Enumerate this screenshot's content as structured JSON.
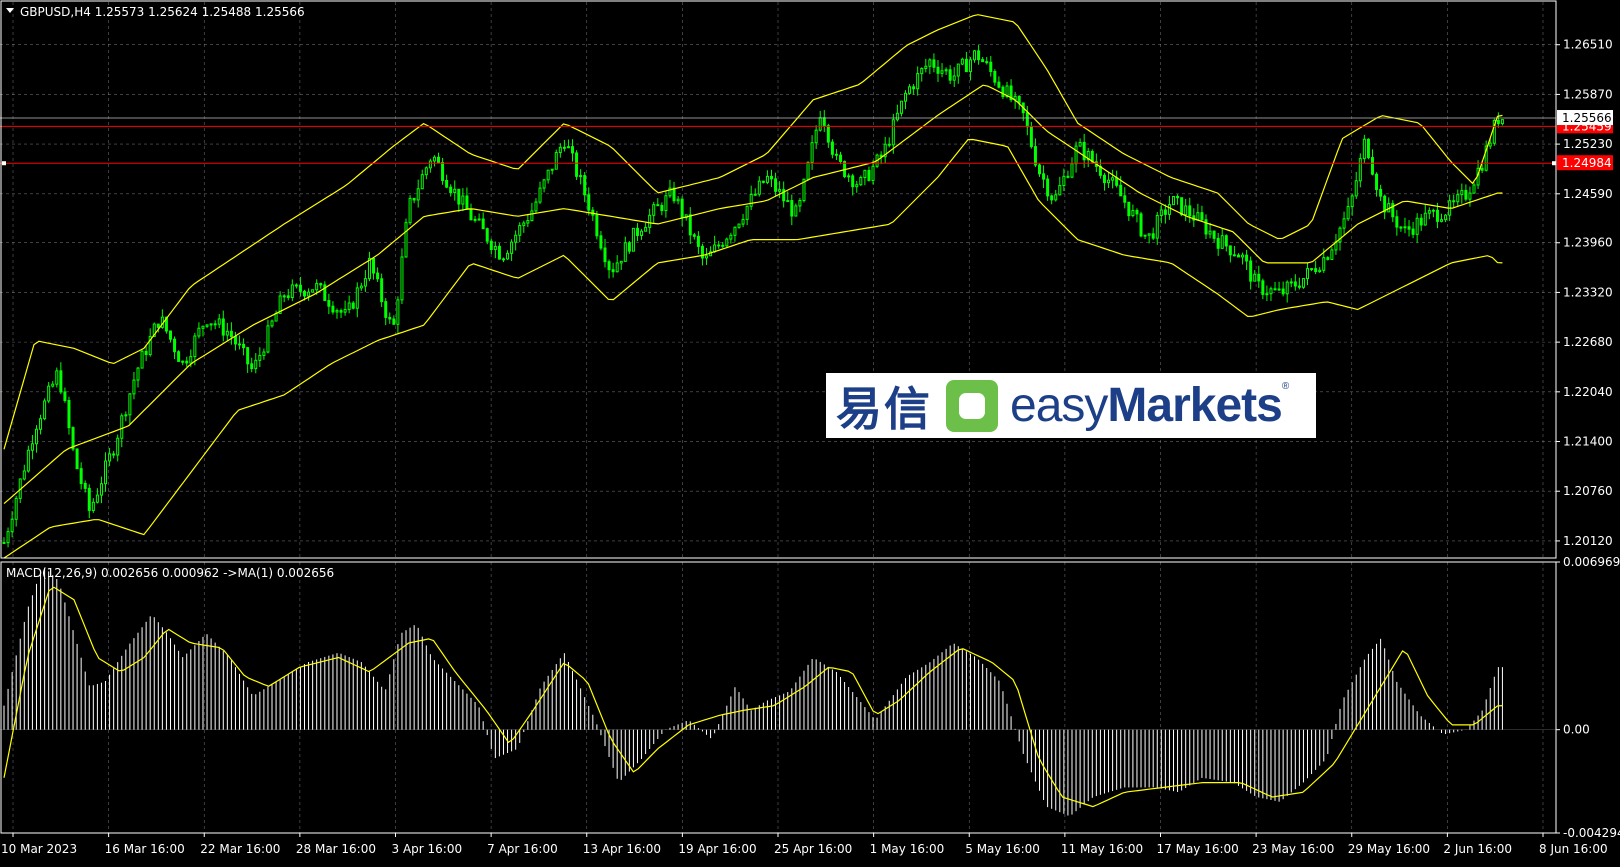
{
  "window": {
    "symbol_header": "GBPUSD,H4  1.25573 1.25624 1.25488 1.25566",
    "macd_header": "MACD(12,26,9) 0.002656 0.000962  ->MA(1) 0.002656"
  },
  "watermark": {
    "chinese_text": "易信",
    "brand_light": "easy",
    "brand_bold": "Markets",
    "registered": "®"
  },
  "colors": {
    "background": "#000000",
    "grid": "#b8b8c8",
    "candle": "#00ff00",
    "bollinger": "#ffff00",
    "level_line": "#ff0000",
    "level_tag": "#ff0000",
    "macd_hist": "#ffffff",
    "macd_signal": "#ffff00",
    "text": "#ffffff"
  },
  "chart_data": [
    {
      "type": "candlestick",
      "symbol": "GBPUSD",
      "timeframe": "H4",
      "ohlc_last": {
        "open": 1.25573,
        "high": 1.25624,
        "low": 1.25488,
        "close": 1.25566
      },
      "ylim": [
        1.199,
        1.2706
      ],
      "y_ticks": [
        "1.26510",
        "1.25870",
        "1.25230",
        "1.24590",
        "1.23960",
        "1.23320",
        "1.22680",
        "1.22040",
        "1.21400",
        "1.20760",
        "1.20120"
      ],
      "y_tick_values": [
        1.2651,
        1.2587,
        1.2523,
        1.2459,
        1.2396,
        1.2332,
        1.2268,
        1.2204,
        1.214,
        1.2076,
        1.2012
      ],
      "current_price_label": "1.25566",
      "current_price": 1.25566,
      "level_lines": [
        {
          "label": "1.25459",
          "value": 1.25459
        },
        {
          "label": "1.24984",
          "value": 1.24984
        }
      ],
      "x_labels": [
        "10 Mar 2023",
        "16 Mar 16:00",
        "22 Mar 16:00",
        "28 Mar 16:00",
        "3 Apr 16:00",
        "7 Apr 16:00",
        "13 Apr 16:00",
        "19 Apr 16:00",
        "25 Apr 16:00",
        "1 May 16:00",
        "5 May 16:00",
        "11 May 16:00",
        "17 May 16:00",
        "23 May 16:00",
        "29 May 16:00",
        "2 Jun 16:00",
        "8 Jun 16:00"
      ],
      "price_path": [
        [
          0,
          1.201
        ],
        [
          0.02,
          1.216
        ],
        [
          0.035,
          1.223
        ],
        [
          0.045,
          1.212
        ],
        [
          0.055,
          1.205
        ],
        [
          0.07,
          1.213
        ],
        [
          0.085,
          1.223
        ],
        [
          0.1,
          1.23
        ],
        [
          0.115,
          1.224
        ],
        [
          0.13,
          1.23
        ],
        [
          0.145,
          1.228
        ],
        [
          0.16,
          1.223
        ],
        [
          0.18,
          1.233
        ],
        [
          0.2,
          1.234
        ],
        [
          0.22,
          1.23
        ],
        [
          0.235,
          1.237
        ],
        [
          0.25,
          1.228
        ],
        [
          0.26,
          1.244
        ],
        [
          0.275,
          1.251
        ],
        [
          0.29,
          1.246
        ],
        [
          0.3,
          1.243
        ],
        [
          0.32,
          1.238
        ],
        [
          0.34,
          1.244
        ],
        [
          0.36,
          1.253
        ],
        [
          0.375,
          1.245
        ],
        [
          0.39,
          1.236
        ],
        [
          0.41,
          1.242
        ],
        [
          0.43,
          1.246
        ],
        [
          0.45,
          1.237
        ],
        [
          0.47,
          1.242
        ],
        [
          0.49,
          1.248
        ],
        [
          0.51,
          1.243
        ],
        [
          0.525,
          1.257
        ],
        [
          0.535,
          1.25
        ],
        [
          0.55,
          1.247
        ],
        [
          0.565,
          1.251
        ],
        [
          0.58,
          1.259
        ],
        [
          0.595,
          1.263
        ],
        [
          0.61,
          1.261
        ],
        [
          0.625,
          1.264
        ],
        [
          0.64,
          1.26
        ],
        [
          0.655,
          1.256
        ],
        [
          0.665,
          1.249
        ],
        [
          0.675,
          1.245
        ],
        [
          0.69,
          1.252
        ],
        [
          0.705,
          1.249
        ],
        [
          0.72,
          1.245
        ],
        [
          0.735,
          1.24
        ],
        [
          0.75,
          1.245
        ],
        [
          0.765,
          1.243
        ],
        [
          0.78,
          1.24
        ],
        [
          0.795,
          1.238
        ],
        [
          0.805,
          1.234
        ],
        [
          0.82,
          1.233
        ],
        [
          0.835,
          1.235
        ],
        [
          0.85,
          1.238
        ],
        [
          0.865,
          1.244
        ],
        [
          0.875,
          1.253
        ],
        [
          0.885,
          1.245
        ],
        [
          0.9,
          1.241
        ],
        [
          0.915,
          1.243
        ],
        [
          0.93,
          1.244
        ],
        [
          0.94,
          1.246
        ],
        [
          0.95,
          1.25
        ],
        [
          0.96,
          1.2557
        ]
      ],
      "bollinger_upper": [
        [
          0,
          1.213
        ],
        [
          0.02,
          1.227
        ],
        [
          0.045,
          1.226
        ],
        [
          0.07,
          1.224
        ],
        [
          0.09,
          1.226
        ],
        [
          0.12,
          1.234
        ],
        [
          0.15,
          1.238
        ],
        [
          0.18,
          1.242
        ],
        [
          0.22,
          1.247
        ],
        [
          0.25,
          1.252
        ],
        [
          0.27,
          1.255
        ],
        [
          0.3,
          1.251
        ],
        [
          0.33,
          1.249
        ],
        [
          0.36,
          1.255
        ],
        [
          0.39,
          1.252
        ],
        [
          0.42,
          1.246
        ],
        [
          0.46,
          1.248
        ],
        [
          0.49,
          1.251
        ],
        [
          0.52,
          1.258
        ],
        [
          0.55,
          1.26
        ],
        [
          0.58,
          1.265
        ],
        [
          0.6,
          1.267
        ],
        [
          0.625,
          1.269
        ],
        [
          0.65,
          1.268
        ],
        [
          0.67,
          1.262
        ],
        [
          0.69,
          1.255
        ],
        [
          0.72,
          1.251
        ],
        [
          0.75,
          1.248
        ],
        [
          0.78,
          1.246
        ],
        [
          0.8,
          1.242
        ],
        [
          0.82,
          1.24
        ],
        [
          0.84,
          1.242
        ],
        [
          0.86,
          1.253
        ],
        [
          0.885,
          1.256
        ],
        [
          0.91,
          1.255
        ],
        [
          0.93,
          1.25
        ],
        [
          0.945,
          1.247
        ],
        [
          0.96,
          1.256
        ]
      ],
      "bollinger_middle": [
        [
          0,
          1.206
        ],
        [
          0.04,
          1.213
        ],
        [
          0.08,
          1.216
        ],
        [
          0.12,
          1.224
        ],
        [
          0.16,
          1.229
        ],
        [
          0.2,
          1.233
        ],
        [
          0.24,
          1.238
        ],
        [
          0.27,
          1.243
        ],
        [
          0.3,
          1.244
        ],
        [
          0.33,
          1.243
        ],
        [
          0.36,
          1.244
        ],
        [
          0.39,
          1.243
        ],
        [
          0.42,
          1.242
        ],
        [
          0.46,
          1.244
        ],
        [
          0.49,
          1.245
        ],
        [
          0.52,
          1.248
        ],
        [
          0.56,
          1.25
        ],
        [
          0.6,
          1.256
        ],
        [
          0.63,
          1.26
        ],
        [
          0.65,
          1.258
        ],
        [
          0.67,
          1.254
        ],
        [
          0.7,
          1.25
        ],
        [
          0.73,
          1.246
        ],
        [
          0.76,
          1.243
        ],
        [
          0.79,
          1.241
        ],
        [
          0.81,
          1.237
        ],
        [
          0.84,
          1.237
        ],
        [
          0.87,
          1.242
        ],
        [
          0.9,
          1.245
        ],
        [
          0.93,
          1.244
        ],
        [
          0.96,
          1.246
        ]
      ],
      "bollinger_lower": [
        [
          0,
          1.199
        ],
        [
          0.03,
          1.203
        ],
        [
          0.06,
          1.204
        ],
        [
          0.09,
          1.202
        ],
        [
          0.12,
          1.21
        ],
        [
          0.15,
          1.218
        ],
        [
          0.18,
          1.22
        ],
        [
          0.21,
          1.224
        ],
        [
          0.24,
          1.227
        ],
        [
          0.27,
          1.229
        ],
        [
          0.3,
          1.237
        ],
        [
          0.33,
          1.235
        ],
        [
          0.36,
          1.238
        ],
        [
          0.39,
          1.232
        ],
        [
          0.42,
          1.237
        ],
        [
          0.45,
          1.238
        ],
        [
          0.48,
          1.24
        ],
        [
          0.51,
          1.24
        ],
        [
          0.54,
          1.241
        ],
        [
          0.57,
          1.242
        ],
        [
          0.6,
          1.248
        ],
        [
          0.62,
          1.253
        ],
        [
          0.645,
          1.252
        ],
        [
          0.665,
          1.245
        ],
        [
          0.69,
          1.24
        ],
        [
          0.72,
          1.238
        ],
        [
          0.75,
          1.237
        ],
        [
          0.78,
          1.233
        ],
        [
          0.8,
          1.23
        ],
        [
          0.82,
          1.231
        ],
        [
          0.85,
          1.232
        ],
        [
          0.87,
          1.231
        ],
        [
          0.9,
          1.234
        ],
        [
          0.93,
          1.237
        ],
        [
          0.955,
          1.238
        ],
        [
          0.96,
          1.237
        ]
      ]
    },
    {
      "type": "bar",
      "name": "MACD(12,26,9)",
      "values_label": "0.002656 0.000962",
      "signal_label": "->MA(1) 0.002656",
      "ylim": [
        -0.004294,
        0.006969
      ],
      "y_ticks": [
        "0.006969",
        "0.00",
        "-0.004294"
      ],
      "y_tick_values": [
        0.006969,
        0.0,
        -0.004294
      ],
      "macd_path": [
        [
          0,
          0.001
        ],
        [
          0.015,
          0.005
        ],
        [
          0.025,
          0.0068
        ],
        [
          0.035,
          0.0062
        ],
        [
          0.045,
          0.004
        ],
        [
          0.055,
          0.0018
        ],
        [
          0.065,
          0.002
        ],
        [
          0.08,
          0.0035
        ],
        [
          0.095,
          0.0048
        ],
        [
          0.105,
          0.004
        ],
        [
          0.115,
          0.003
        ],
        [
          0.13,
          0.004
        ],
        [
          0.145,
          0.003
        ],
        [
          0.16,
          0.0014
        ],
        [
          0.175,
          0.002
        ],
        [
          0.195,
          0.0028
        ],
        [
          0.215,
          0.0032
        ],
        [
          0.23,
          0.0028
        ],
        [
          0.245,
          0.0016
        ],
        [
          0.255,
          0.004
        ],
        [
          0.265,
          0.0044
        ],
        [
          0.275,
          0.003
        ],
        [
          0.29,
          0.002
        ],
        [
          0.305,
          0.001
        ],
        [
          0.315,
          -0.0012
        ],
        [
          0.33,
          -0.0008
        ],
        [
          0.345,
          0.0018
        ],
        [
          0.36,
          0.0032
        ],
        [
          0.37,
          0.0018
        ],
        [
          0.38,
          0.0004
        ],
        [
          0.395,
          -0.0022
        ],
        [
          0.41,
          -0.0012
        ],
        [
          0.425,
          0.0
        ],
        [
          0.44,
          0.0004
        ],
        [
          0.455,
          -0.0004
        ],
        [
          0.47,
          0.0018
        ],
        [
          0.48,
          0.0008
        ],
        [
          0.49,
          0.0012
        ],
        [
          0.505,
          0.0016
        ],
        [
          0.52,
          0.003
        ],
        [
          0.535,
          0.0024
        ],
        [
          0.55,
          0.0012
        ],
        [
          0.56,
          0.0004
        ],
        [
          0.58,
          0.0022
        ],
        [
          0.595,
          0.0028
        ],
        [
          0.61,
          0.0036
        ],
        [
          0.625,
          0.003
        ],
        [
          0.64,
          0.002
        ],
        [
          0.655,
          -0.001
        ],
        [
          0.67,
          -0.0032
        ],
        [
          0.685,
          -0.0036
        ],
        [
          0.7,
          -0.0028
        ],
        [
          0.72,
          -0.0024
        ],
        [
          0.74,
          -0.0024
        ],
        [
          0.755,
          -0.0026
        ],
        [
          0.77,
          -0.002
        ],
        [
          0.79,
          -0.0022
        ],
        [
          0.805,
          -0.0028
        ],
        [
          0.82,
          -0.003
        ],
        [
          0.835,
          -0.0022
        ],
        [
          0.85,
          -0.0012
        ],
        [
          0.86,
          0.0012
        ],
        [
          0.875,
          0.003
        ],
        [
          0.885,
          0.0038
        ],
        [
          0.895,
          0.002
        ],
        [
          0.91,
          0.0006
        ],
        [
          0.925,
          -0.0002
        ],
        [
          0.94,
          0.0
        ],
        [
          0.95,
          0.0008
        ],
        [
          0.96,
          0.0026
        ]
      ],
      "signal_path": [
        [
          0,
          -0.002
        ],
        [
          0.015,
          0.003
        ],
        [
          0.03,
          0.006
        ],
        [
          0.045,
          0.0054
        ],
        [
          0.06,
          0.003
        ],
        [
          0.075,
          0.0024
        ],
        [
          0.09,
          0.003
        ],
        [
          0.105,
          0.0042
        ],
        [
          0.12,
          0.0036
        ],
        [
          0.14,
          0.0034
        ],
        [
          0.155,
          0.0022
        ],
        [
          0.17,
          0.0018
        ],
        [
          0.19,
          0.0026
        ],
        [
          0.215,
          0.003
        ],
        [
          0.235,
          0.0024
        ],
        [
          0.26,
          0.0036
        ],
        [
          0.275,
          0.0038
        ],
        [
          0.29,
          0.0024
        ],
        [
          0.31,
          0.0008
        ],
        [
          0.325,
          -0.0006
        ],
        [
          0.34,
          0.0008
        ],
        [
          0.36,
          0.0028
        ],
        [
          0.375,
          0.002
        ],
        [
          0.39,
          -0.0004
        ],
        [
          0.405,
          -0.0018
        ],
        [
          0.42,
          -0.0008
        ],
        [
          0.44,
          0.0002
        ],
        [
          0.46,
          0.0006
        ],
        [
          0.475,
          0.0008
        ],
        [
          0.495,
          0.001
        ],
        [
          0.515,
          0.0018
        ],
        [
          0.53,
          0.0026
        ],
        [
          0.545,
          0.0024
        ],
        [
          0.56,
          0.0006
        ],
        [
          0.575,
          0.0012
        ],
        [
          0.595,
          0.0024
        ],
        [
          0.615,
          0.0034
        ],
        [
          0.635,
          0.0028
        ],
        [
          0.65,
          0.002
        ],
        [
          0.665,
          -0.0012
        ],
        [
          0.68,
          -0.0028
        ],
        [
          0.7,
          -0.0032
        ],
        [
          0.72,
          -0.0026
        ],
        [
          0.745,
          -0.0024
        ],
        [
          0.77,
          -0.0022
        ],
        [
          0.795,
          -0.0022
        ],
        [
          0.815,
          -0.0028
        ],
        [
          0.835,
          -0.0026
        ],
        [
          0.855,
          -0.0014
        ],
        [
          0.87,
          0.0002
        ],
        [
          0.885,
          0.0018
        ],
        [
          0.9,
          0.0034
        ],
        [
          0.915,
          0.0014
        ],
        [
          0.93,
          0.0002
        ],
        [
          0.945,
          0.0002
        ],
        [
          0.96,
          0.001
        ]
      ]
    }
  ]
}
